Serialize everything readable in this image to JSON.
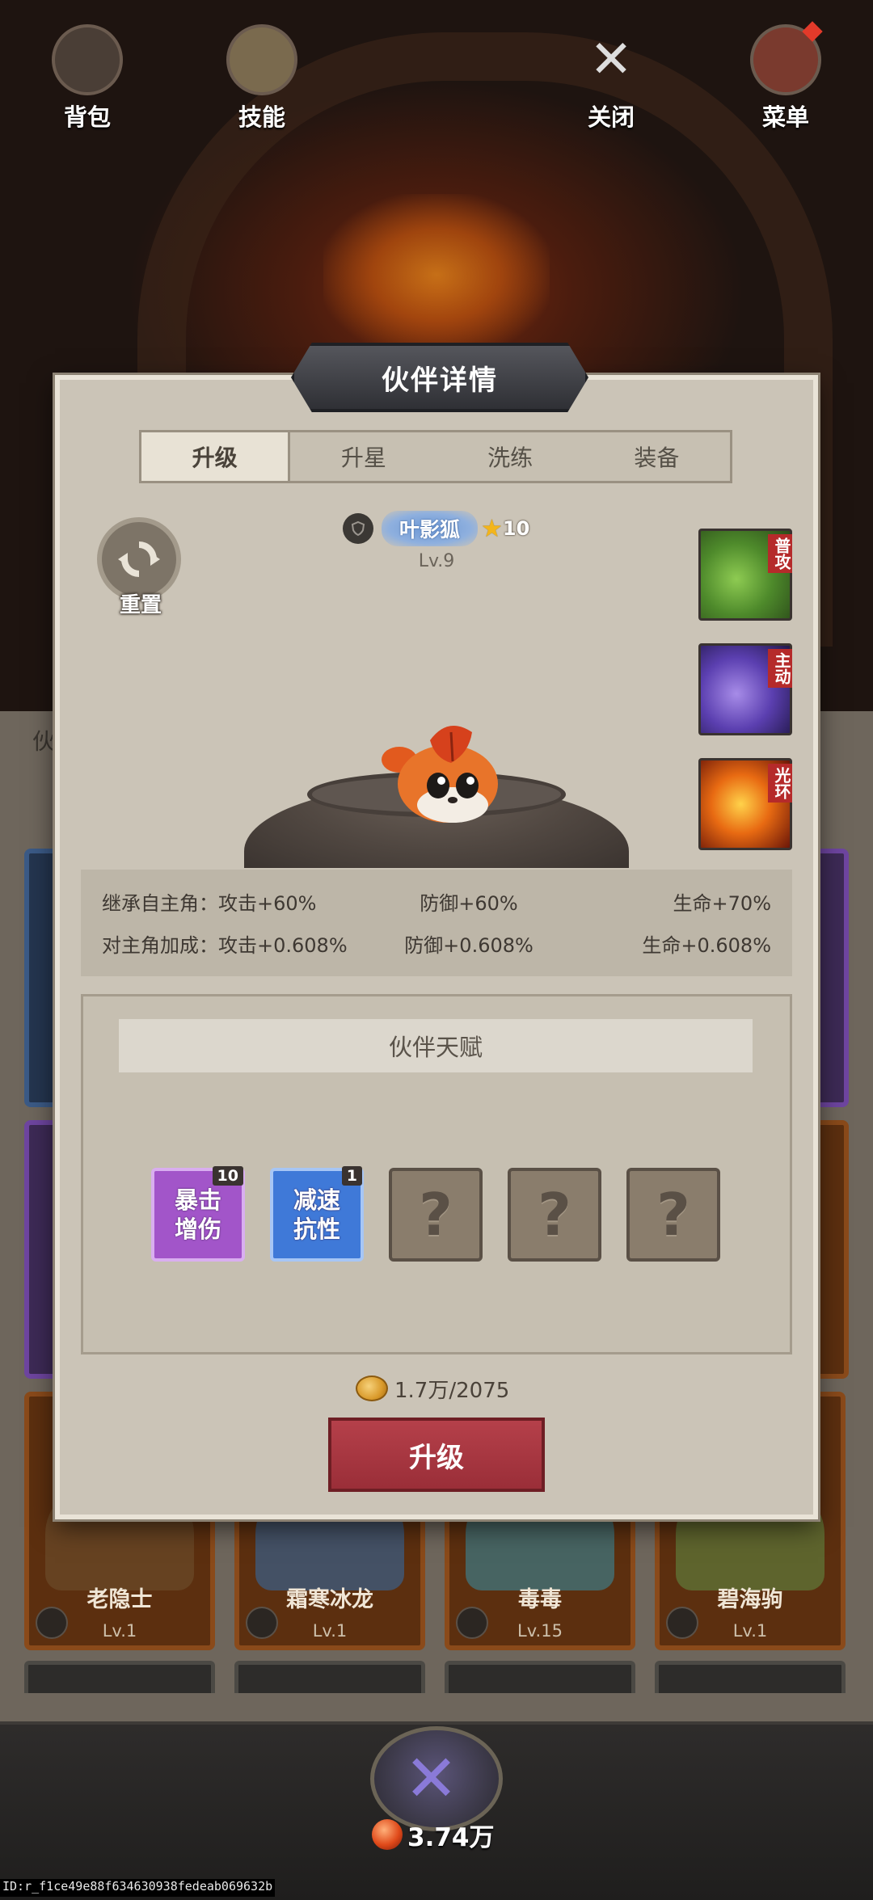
{
  "dialog": {
    "title": "伙伴详情",
    "tabs": [
      "升级",
      "升星",
      "洗练",
      "装备"
    ],
    "reset_label": "重置",
    "pet": {
      "name": "叶影狐",
      "stars": "10",
      "level": "Lv.9"
    },
    "skills": [
      {
        "tag": "普攻",
        "color": "#4e8a2b"
      },
      {
        "tag": "主动",
        "color": "#5b3fb0"
      },
      {
        "tag": "光环",
        "color": "#e86a12"
      }
    ],
    "stats": {
      "inherit": {
        "label": "继承自主角：攻击+60%",
        "defense": "防御+60%",
        "hp": "生命+70%"
      },
      "bonus": {
        "label": "对主角加成：攻击+0.608%",
        "defense": "防御+0.608%",
        "hp": "生命+0.608%"
      }
    },
    "talents": {
      "header": "伙伴天赋",
      "items": [
        {
          "name": "暴击\n增伤",
          "level": "10",
          "color": "#a255c9"
        },
        {
          "name": "减速\n抗性",
          "level": "1",
          "color": "#3f79d8"
        },
        {
          "name": "?",
          "locked": true
        },
        {
          "name": "?",
          "locked": true
        },
        {
          "name": "?",
          "locked": true
        }
      ]
    },
    "cost": "1.7万/2075",
    "upgrade_label": "升级"
  },
  "background_cards": [
    {
      "name": "老隐士",
      "level": "Lv.1"
    },
    {
      "name": "霜寒冰龙",
      "level": "Lv.1"
    },
    {
      "name": "毒毒",
      "level": "Lv.15"
    },
    {
      "name": "碧海驹",
      "level": "Lv.1"
    }
  ],
  "background_fragment": "伙",
  "navbar": {
    "bag": "背包",
    "skill": "技能",
    "power": "3.74万",
    "close": "关闭",
    "menu": "菜单"
  },
  "id_strip": "ID:r_f1ce49e88f634630938fedeab069632b"
}
